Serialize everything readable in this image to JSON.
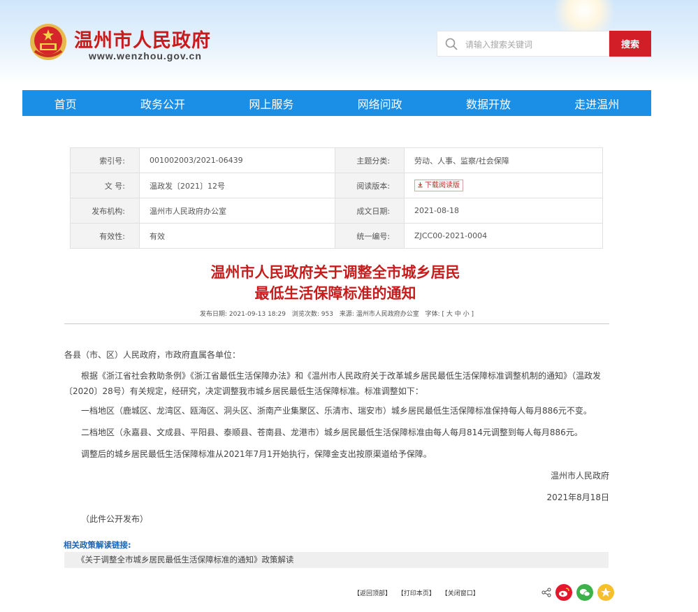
{
  "header": {
    "site_title": "温州市人民政府",
    "site_url": "www.wenzhou.gov.cn",
    "search_placeholder": "请输入搜索关键词",
    "search_button": "搜索"
  },
  "nav": [
    "首页",
    "政务公开",
    "网上服务",
    "网络问政",
    "数据开放",
    "走进温州"
  ],
  "meta": {
    "index_label": "索引号:",
    "index_value": "001002003/2021-06439",
    "topic_label": "主题分类:",
    "topic_value": "劳动、人事、监察/社会保障",
    "doc_no_label": "文 号:",
    "doc_no_value": "温政发〔2021〕12号",
    "reading_label": "阅读版本:",
    "reading_badge": "下载阅读版",
    "issuer_label": "发布机构:",
    "issuer_value": "温州市人民政府办公室",
    "date_label": "成文日期:",
    "date_value": "2021-08-18",
    "validity_label": "有效性:",
    "validity_value": "有效",
    "serial_label": "统一编号:",
    "serial_value": "ZJCC00-2021-0004"
  },
  "article": {
    "title_line1": "温州市人民政府关于调整全市城乡居民",
    "title_line2": "最低生活保障标准的通知",
    "pub_date": "发布日期: 2021-09-13 18:29",
    "views": "浏览次数: 953",
    "source": "来源: 温州市人民政府办公室",
    "font_size": "字体: [ 大 中 小 ]",
    "salutation": "各县（市、区）人民政府，市政府直属各单位：",
    "para1": "根据《浙江省社会救助条例》《浙江省最低生活保障办法》和《温州市人民政府关于改革城乡居民最低生活保障标准调整机制的通知》（温政发〔2020〕28号）有关规定，经研究，决定调整我市城乡居民最低生活保障标准。标准调整如下：",
    "para2": "一档地区（鹿城区、龙湾区、瓯海区、洞头区、浙南产业集聚区、乐清市、瑞安市）城乡居民最低生活保障标准保持每人每月886元不变。",
    "para3": "二档地区（永嘉县、文成县、平阳县、泰顺县、苍南县、龙港市）城乡居民最低生活保障标准由每人每月814元调整到每人每月886元。",
    "para4": "调整后的城乡居民最低生活保障标准从2021年7月1开始执行，保障金支出按原渠道给予保障。",
    "signature": "温州市人民政府",
    "sign_date": "2021年8月18日",
    "public_note": "（此件公开发布）"
  },
  "related": {
    "label": "相关政策解读链接:",
    "link": "《关于调整全市城乡居民最低生活保障标准的通知》政策解读"
  },
  "footer": {
    "back_top": "【返回顶部】",
    "print": "【打印本页】",
    "close": "【关闭窗口】"
  },
  "colors": {
    "brand_red": "#c81c1c",
    "nav_blue": "#1b8ee6",
    "search_red": "#d21f27",
    "link_blue": "#1a64b7"
  }
}
